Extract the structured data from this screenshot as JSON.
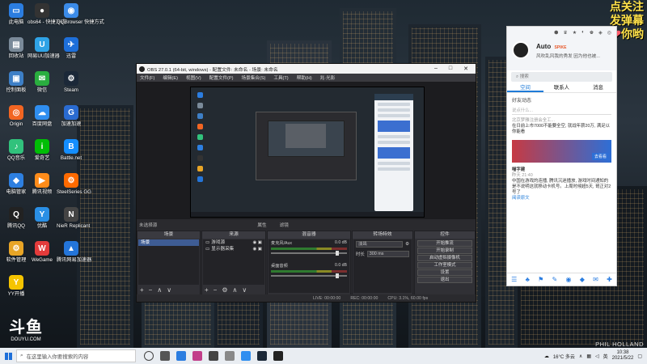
{
  "desktop_icons": [
    {
      "label": "此电脑",
      "glyph": "▭",
      "color": "#2b7de0"
    },
    {
      "label": "obs64 - 快捷方式",
      "glyph": "●",
      "color": "#333"
    },
    {
      "label": "QQBrowser 快捷方式",
      "glyph": "◉",
      "color": "#3b8be8"
    },
    {
      "label": "回收站",
      "glyph": "▤",
      "color": "#7a8a99"
    },
    {
      "label": "网易UU加速器",
      "glyph": "U",
      "color": "#2fa3e6"
    },
    {
      "label": "迅雷",
      "glyph": "✈",
      "color": "#1e6fd9"
    },
    {
      "label": "控制面板",
      "glyph": "▣",
      "color": "#3d7fc6"
    },
    {
      "label": "微信",
      "glyph": "✉",
      "color": "#2aae3f"
    },
    {
      "label": "Steam",
      "glyph": "⚙",
      "color": "#1b2838"
    },
    {
      "label": "Origin",
      "glyph": "◎",
      "color": "#f26522"
    },
    {
      "label": "百度网盘",
      "glyph": "☁",
      "color": "#2f8ef0"
    },
    {
      "label": "加速加速",
      "glyph": "G",
      "color": "#2a6bd1"
    },
    {
      "label": "QQ音乐",
      "glyph": "♪",
      "color": "#31c27c"
    },
    {
      "label": "爱奇艺",
      "glyph": "i",
      "color": "#00be06"
    },
    {
      "label": "Battle.net",
      "glyph": "B",
      "color": "#148eff"
    },
    {
      "label": "电脑管家",
      "glyph": "◆",
      "color": "#2d7fe0"
    },
    {
      "label": "腾讯视频",
      "glyph": "▶",
      "color": "#ff8c1a"
    },
    {
      "label": "SteelSeries GG",
      "glyph": "⚙",
      "color": "#ff6a00"
    },
    {
      "label": "腾讯QQ",
      "glyph": "Q",
      "color": "#222"
    },
    {
      "label": "优酷",
      "glyph": "Y",
      "color": "#2a8fe5"
    },
    {
      "label": "NieR Replicant",
      "glyph": "N",
      "color": "#444"
    },
    {
      "label": "软件管理",
      "glyph": "⚙",
      "color": "#e8a526"
    },
    {
      "label": "WeGame",
      "glyph": "W",
      "color": "#e33b3b"
    },
    {
      "label": "腾讯网易加速器",
      "glyph": "▲",
      "color": "#2475d9"
    },
    {
      "label": "YY开播",
      "glyph": "Y",
      "color": "#f5c400"
    }
  ],
  "overlay": {
    "line1": "点关注",
    "line2": "发弹幕",
    "line3": "你哟",
    "heart": "❤",
    "logo": "斗鱼",
    "logo_sub": "DOUYU.COM",
    "watermark": "PHIL HOLLAND"
  },
  "obs": {
    "title": "OBS 27.0.1 (64-bit, windows) - 配置文件: 未命名 - 场景: 未命名",
    "menu": [
      "文件(F)",
      "编辑(E)",
      "视图(V)",
      "配置文件(P)",
      "场景集合(S)",
      "工具(T)",
      "帮助(H)",
      "兆·光影"
    ],
    "preview_label": "未选择源",
    "preview_btns": [
      "属性",
      "滤镜"
    ],
    "docks": {
      "scenes": {
        "title": "场景",
        "items": [
          "场景"
        ]
      },
      "sources": {
        "title": "来源",
        "items": [
          "游戏源",
          "显示器采集"
        ]
      },
      "mixer": {
        "title": "混音器",
        "channels": [
          {
            "name": "麦克风/Aux",
            "db": "0.0 dB"
          },
          {
            "name": "桌面音频",
            "db": "0.0 dB"
          }
        ]
      },
      "transitions": {
        "title": "转场特效",
        "type": "淡出",
        "duration_label": "时长",
        "duration_value": "300 ms"
      },
      "controls": {
        "title": "控件",
        "buttons": [
          "开始推流",
          "开始录制",
          "启动虚拟摄像机",
          "工作室模式",
          "设置",
          "退出"
        ]
      }
    },
    "status": {
      "live": "LIVE: 00:00:00",
      "rec": "REC: 00:00:00",
      "cpu": "CPU: 3.1%, 60.00 fps"
    }
  },
  "qq": {
    "top_icons": [
      "⬢",
      "♛",
      "★",
      "◐",
      "♚",
      "◈",
      "◎"
    ],
    "name": "Auto",
    "badge": "SPIKE",
    "signature": "风吹乱风我的秀发 因为他也被...",
    "search_placeholder": "搜索",
    "tabs": [
      "空间",
      "联系人",
      "消息"
    ],
    "active_tab": "空间",
    "section_title": "好友动态",
    "comment_placeholder": "说点什么...",
    "post1_head": "北京梦雅注册会全工...",
    "post1_text": "在日前上市7000不能要全空, 就战年薪20万, 满足以你能看",
    "ad_button": "去看看",
    "post2_user": "喵字建",
    "post2_time": "昨天 21:40",
    "post2_text": "中国在游戏的连播, 腾讯沉迷播放, 游戏时间通知的是不说明这就移动卡机号。上周时候超5天, 哥正对2号了",
    "post2_tail": "阅读原文",
    "bottom_icons": [
      "☰",
      "♣",
      "⚑",
      "✎",
      "◉",
      "◆",
      "✉",
      "✚"
    ]
  },
  "taskbar": {
    "search_placeholder": "在这里输入你要搜索的内容",
    "weather": "16°C 多云",
    "time": "10:38",
    "date": "2021/5/22",
    "lang": "英"
  }
}
